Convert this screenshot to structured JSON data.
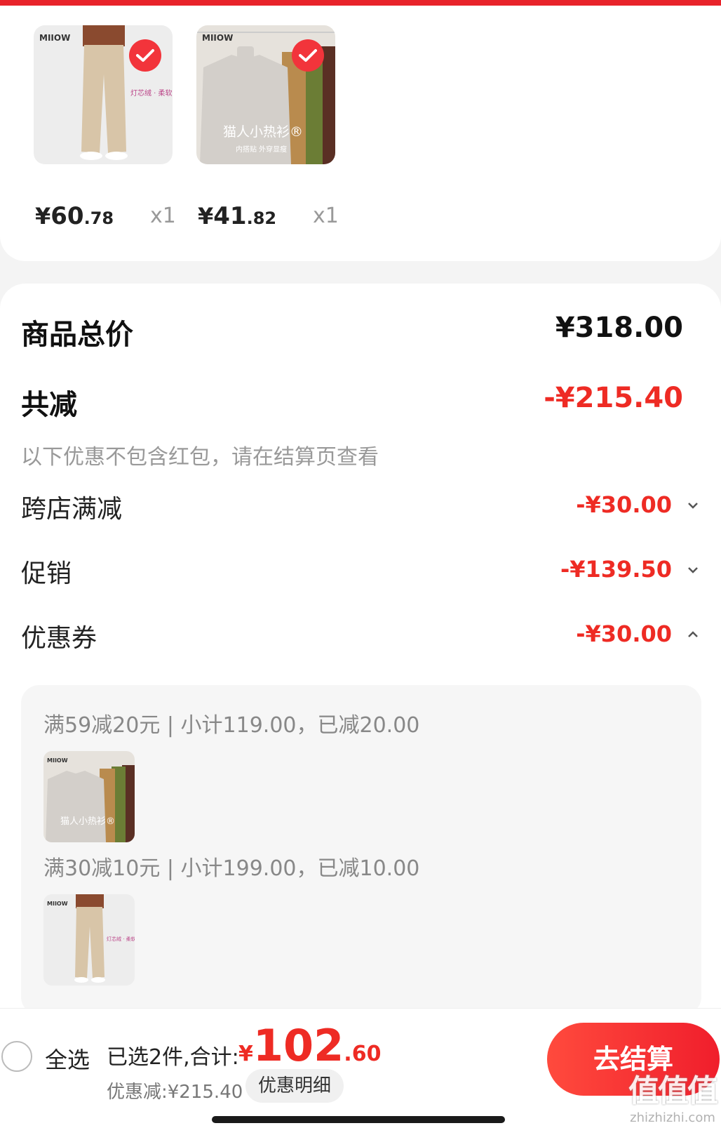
{
  "products": [
    {
      "image": "beige-pants-photo",
      "brand": "MIIOW",
      "img_caption": "灯芯绒 · 柔软 亲肤",
      "price_int": "60",
      "price_dec": ".78",
      "currency": "¥",
      "qty": "x1",
      "selected": true
    },
    {
      "image": "turtleneck-sweaters-photo",
      "brand": "MIIOW",
      "img_caption": "猫人小热衫®",
      "img_sub": "内搭贴 外穿显瘦",
      "price_int": "41",
      "price_dec": ".82",
      "currency": "¥",
      "qty": "x1",
      "selected": true
    }
  ],
  "summary": {
    "total_label": "商品总价",
    "total_value": "¥318.00",
    "reduce_label": "共减",
    "reduce_value": "-¥215.40",
    "note": "以下优惠不包含红包，请在结算页查看",
    "rows": [
      {
        "label": "跨店满减",
        "value": "-¥30.00",
        "expanded": false
      },
      {
        "label": "促销",
        "value": "-¥139.50",
        "expanded": false
      },
      {
        "label": "优惠券",
        "value": "-¥30.00",
        "expanded": true
      }
    ],
    "coupons": [
      {
        "text": "满59减20元 | 小计119.00，已减20.00",
        "image": "turtleneck-sweaters-photo"
      },
      {
        "text": "满30减10元 | 小计199.00，已减10.00",
        "image": "beige-pants-photo"
      }
    ]
  },
  "bottom_bar": {
    "select_all": "全选",
    "selected_text": "已选2件,合计:",
    "total_currency": "¥",
    "total_int": "102",
    "total_dec": ".60",
    "discount_text": "优惠减:¥215.40",
    "detail_button": "优惠明细",
    "checkout_button": "去结算"
  },
  "watermark": {
    "logo": "值值值",
    "url": "zhizhizhi.com"
  },
  "colors": {
    "accent_red": "#ee2b24",
    "check_red": "#f2343b",
    "background": "#f4f4f4"
  }
}
